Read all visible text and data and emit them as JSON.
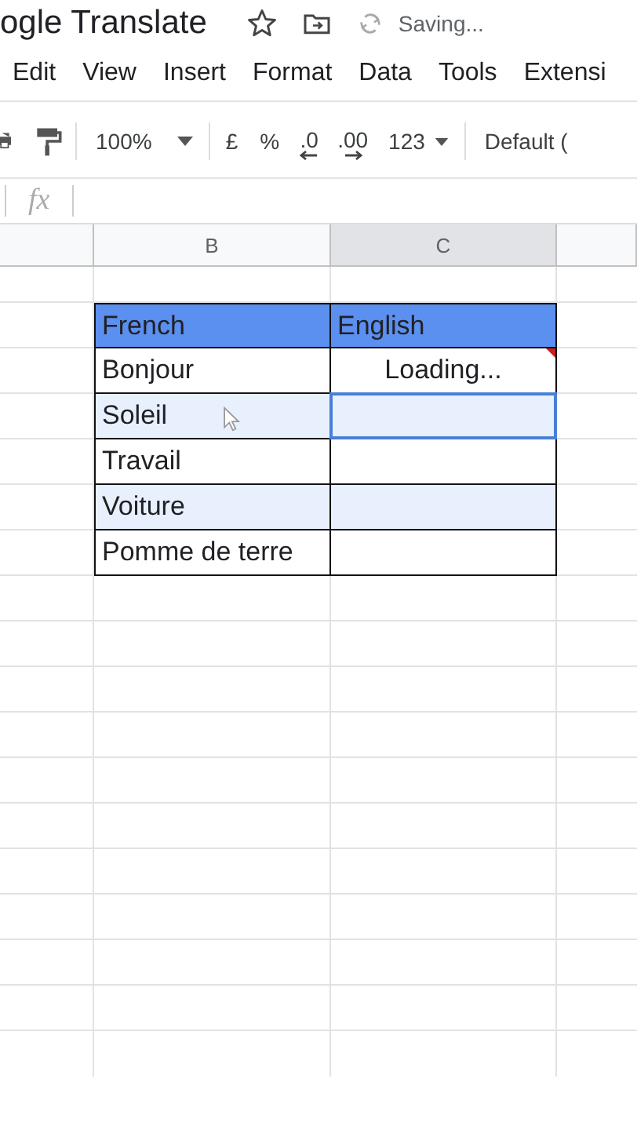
{
  "document": {
    "title": "ogle Translate",
    "status": "Saving..."
  },
  "menu": [
    "Edit",
    "View",
    "Insert",
    "Format",
    "Data",
    "Tools",
    "Extensi"
  ],
  "toolbar": {
    "zoom": "100%",
    "currency": "£",
    "percent": "%",
    "decrease_decimals": ".0",
    "increase_decimals": ".00",
    "number_format": "123",
    "font": "Default ("
  },
  "formula_bar": {
    "label": "fx"
  },
  "columns": [
    {
      "label": "B",
      "selected": false
    },
    {
      "label": "C",
      "selected": true
    }
  ],
  "table": {
    "headers": [
      "French",
      "English"
    ],
    "rows": [
      {
        "french": "Bonjour",
        "english": "Loading...",
        "banded": false,
        "selected": false,
        "note": true
      },
      {
        "french": "Soleil",
        "english": "",
        "banded": true,
        "selected": true,
        "note": false
      },
      {
        "french": "Travail",
        "english": "",
        "banded": false,
        "selected": false,
        "note": false
      },
      {
        "french": "Voiture",
        "english": "",
        "banded": true,
        "selected": false,
        "note": false
      },
      {
        "french": "Pomme de terre",
        "english": "",
        "banded": false,
        "selected": false,
        "note": false
      }
    ]
  }
}
